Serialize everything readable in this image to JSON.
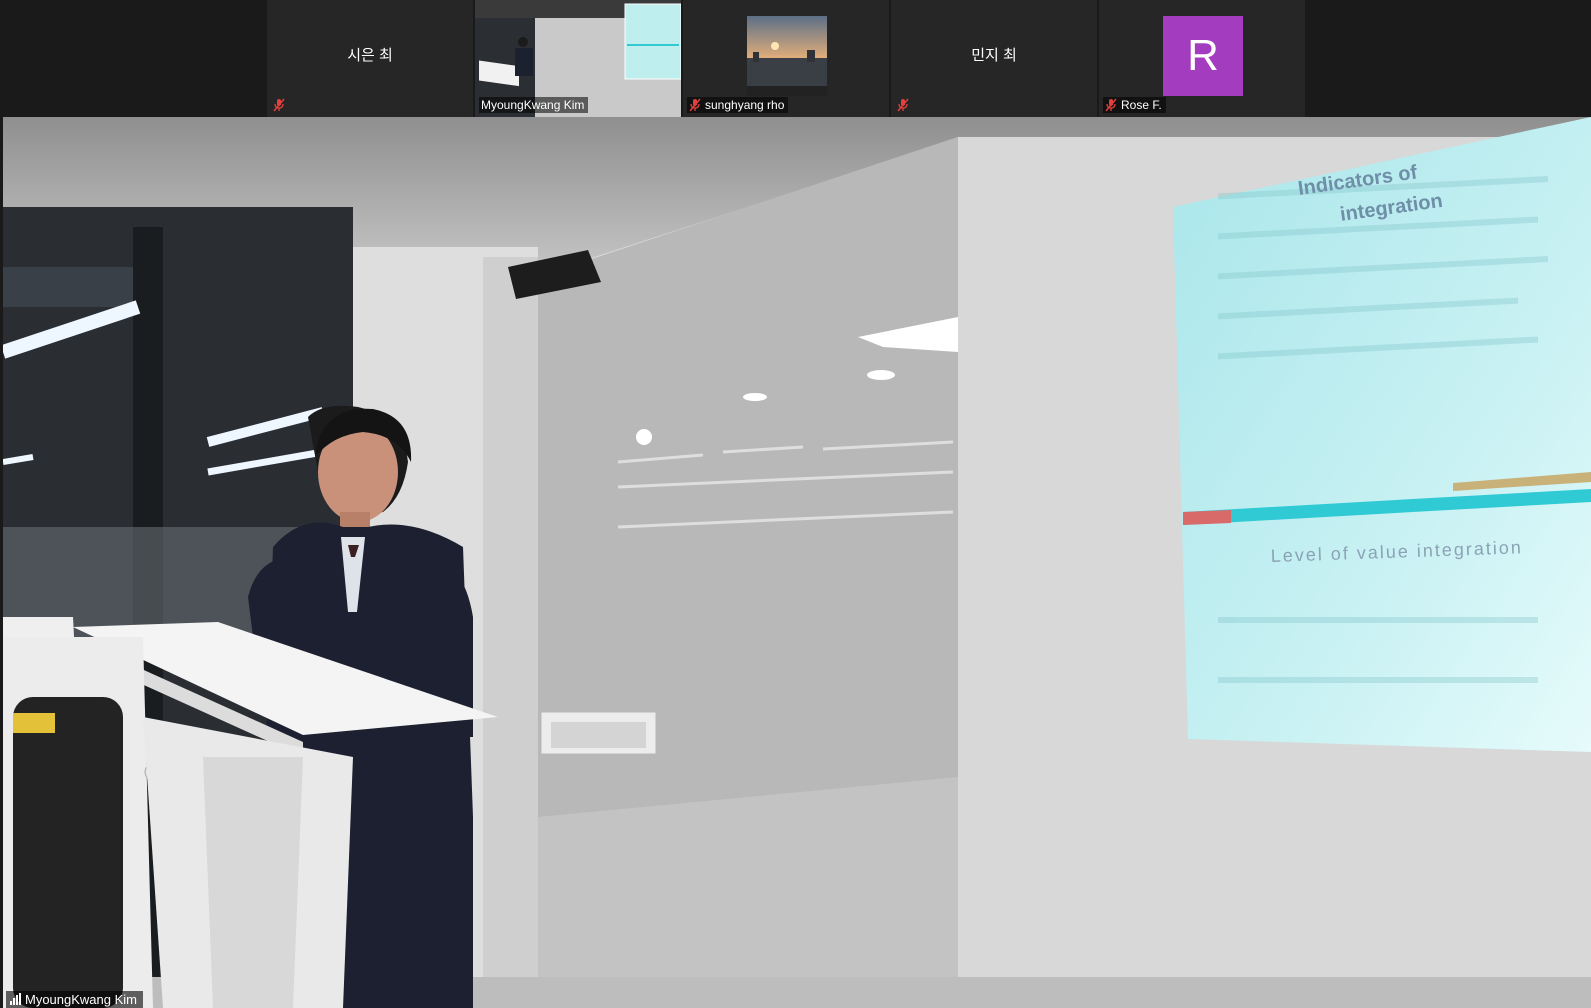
{
  "participants": [
    {
      "name": "시은 최",
      "label": "",
      "muted": true,
      "type": "name"
    },
    {
      "name": "",
      "label": "MyoungKwang Kim",
      "muted": false,
      "type": "video",
      "active": true
    },
    {
      "name": "",
      "label": "sunghyang rho",
      "muted": true,
      "type": "photo"
    },
    {
      "name": "민지 최",
      "label": "",
      "muted": true,
      "type": "name"
    },
    {
      "name": "R",
      "label": "Rose F.",
      "muted": true,
      "type": "avatar"
    }
  ],
  "speaker": {
    "label": "MyoungKwang Kim"
  },
  "slide": {
    "title_line1": "Indicators of",
    "title_line2": "integration",
    "subheading": "Level of value integration"
  },
  "colors": {
    "avatar_bg": "#a33cbf",
    "active_border": "#8bd14a",
    "mute_red": "#e0413e"
  },
  "icons": {
    "muted": "microphone-muted-icon",
    "signal": "signal-strength-icon"
  }
}
